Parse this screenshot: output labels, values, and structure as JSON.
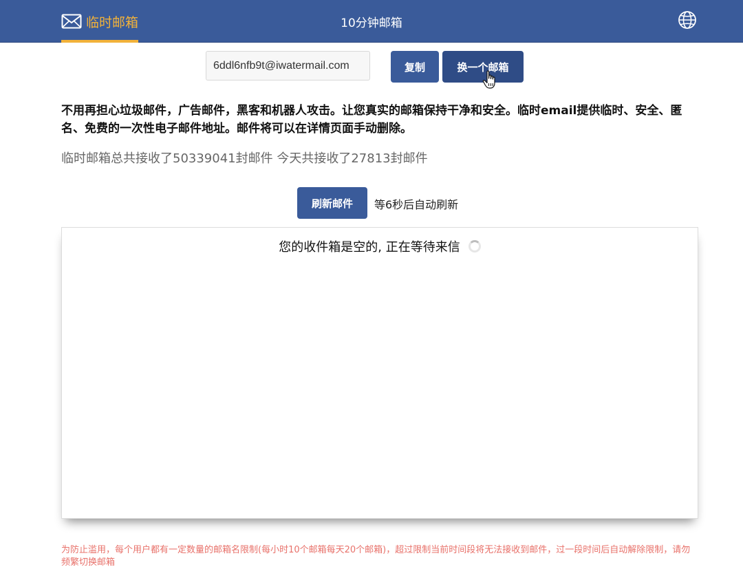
{
  "header": {
    "brand_label": "临时邮箱",
    "center_link": "10分钟邮箱",
    "brand_color": "#f2b23a",
    "bar_color": "#3a5b9a"
  },
  "email": {
    "address": "6ddl6nfb9t@iwatermail.com",
    "copy_label": "复制",
    "change_label": "换一个邮箱"
  },
  "intro": {
    "text": "不用再担心垃圾邮件，广告邮件，黑客和机器人攻击。让您真实的邮箱保持干净和安全。临时email提供临时、安全、匿名、免费的一次性电子邮件地址。邮件将可以在详情页面手动删除。",
    "stats": "临时邮箱总共接收了50339041封邮件 今天共接收了27813封邮件"
  },
  "refresh": {
    "button_label": "刷新邮件",
    "countdown": "等6秒后自动刷新"
  },
  "inbox": {
    "empty_message": "您的收件箱是空的, 正在等待来信"
  },
  "notice": {
    "text": "为防止滥用，每个用户都有一定数量的邮箱名限制(每小时10个邮箱每天20个邮箱)，超过限制当前时间段将无法接收到邮件，过一段时间后自动解除限制，请勿频繁切换邮箱",
    "color": "#e8716a"
  },
  "icons": {
    "brand": "envelope-icon",
    "language": "globe-icon",
    "loading": "spinner-icon",
    "pointer": "hand-cursor-icon"
  }
}
